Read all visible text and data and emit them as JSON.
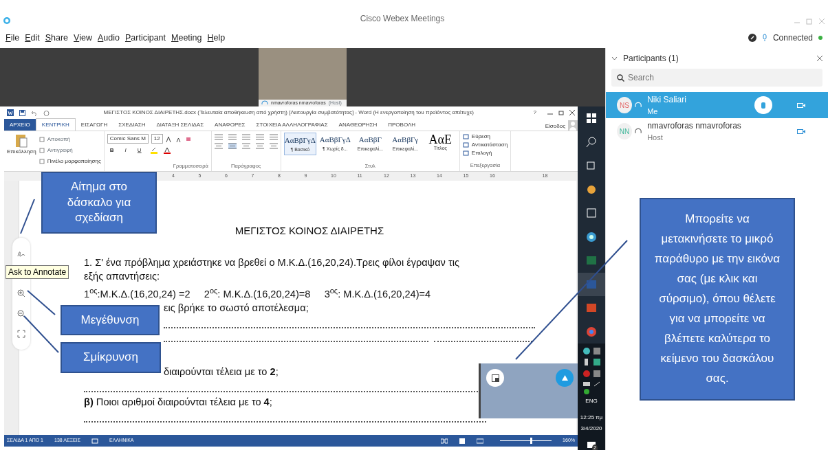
{
  "window": {
    "title": "Cisco Webex Meetings"
  },
  "menu": [
    {
      "label": "File"
    },
    {
      "label": "Edit"
    },
    {
      "label": "Share"
    },
    {
      "label": "View"
    },
    {
      "label": "Audio"
    },
    {
      "label": "Participant"
    },
    {
      "label": "Meeting"
    },
    {
      "label": "Help"
    }
  ],
  "connection": {
    "label": "Connected",
    "connected": true
  },
  "stage": {
    "name": "nmavroforas nmavroforas",
    "role": "(Host)"
  },
  "word": {
    "title": "ΜΕΓΙΣΤΟΣ ΚΟΙΝΟΣ ΔΙΑΙΡΕΤΗΣ.docx (Τελευταία αποθήκευση από χρήστη) [Λειτουργία συμβατότητας] - Word (Η ενεργοποίηση του προϊόντος απέτυχε)",
    "help": "?",
    "tabs": [
      {
        "label": "ΑΡΧΕΙΟ",
        "kind": "file",
        "selected": false
      },
      {
        "label": "ΚΕΝΤΡΙΚΗ",
        "kind": "tab",
        "selected": true
      },
      {
        "label": "ΕΙΣΑΓΩΓΗ",
        "kind": "tab",
        "selected": false
      },
      {
        "label": "ΣΧΕΔΙΑΣΗ",
        "kind": "tab",
        "selected": false
      },
      {
        "label": "ΔΙΑΤΑΞΗ ΣΕΛΙΔΑΣ",
        "kind": "tab",
        "selected": false
      },
      {
        "label": "ΑΝΑΦΟΡΕΣ",
        "kind": "tab",
        "selected": false
      },
      {
        "label": "ΣΤΟΙΧΕΙΑ ΑΛΛΗΛΟΓΡΑΦΙΑΣ",
        "kind": "tab",
        "selected": false
      },
      {
        "label": "ΑΝΑΘΕΩΡΗΣΗ",
        "kind": "tab",
        "selected": false
      },
      {
        "label": "ΠΡΟΒΟΛΗ",
        "kind": "tab",
        "selected": false
      }
    ],
    "sign_in": "Είσοδος",
    "clipboard": {
      "paste": "Επικόλληση",
      "items": [
        "Αποκοπή",
        "Αντιγραφή",
        "Πινέλο μορφοποίησης"
      ]
    },
    "font": {
      "name": "Comic Sans M",
      "size": "12",
      "label": "Γραμματοσειρά",
      "buttons": [
        "B",
        "I",
        "U"
      ]
    },
    "paragraph_label": "Παράγραφος",
    "styles": {
      "label": "Στυλ",
      "items": [
        {
          "sample": "ΑαΒβΓγΔ",
          "name": "¶ Βασικό",
          "selected": true
        },
        {
          "sample": "ΑαΒβΓγΔ",
          "name": "¶ Χωρίς δ...",
          "selected": false
        },
        {
          "sample": "ΑαΒβΓ",
          "name": "Επικεφαλί...",
          "selected": false
        },
        {
          "sample": "ΑαΒβΓγ",
          "name": "Επικεφαλί...",
          "selected": false
        },
        {
          "sample": "ΑαΕ",
          "name": "Τίτλος",
          "selected": false
        }
      ]
    },
    "editing": {
      "label": "Επεξεργασία",
      "items": [
        "Εύρεση",
        "Αντικατάσταση",
        "Επιλογή"
      ]
    },
    "ruler": [
      "4",
      "5",
      "6",
      "7",
      "8",
      "9",
      "10",
      "11",
      "12",
      "13",
      "14",
      "15",
      "16",
      "18"
    ],
    "document": {
      "title": "ΜΕΓΙΣΤΟΣ ΚΟΙΝΟΣ ΔΙΑΙΡΕΤΗΣ",
      "lines": [
        {
          "kind": "text",
          "text": "1. Σ' ένα πρόβλημα χρειάστηκε να βρεθεί ο Μ.Κ.Δ.(16,20,24).Τρεις φίλοι έγραψαν τις"
        },
        {
          "kind": "text",
          "text": "εξής απαντήσεις:"
        },
        {
          "kind": "text",
          "text": "1$^{ος}$:Μ.Κ.Δ.(16,20,24) =2     2$^{ος}$: Μ.Κ.Δ.(16,20,24)=8     3$^{ος}$: Μ.Κ.Δ.(16,20,24)=4"
        },
        {
          "kind": "partial",
          "text": "εις βρήκε το σωστό αποτέλεσμα;"
        },
        {
          "kind": "dots_partial"
        },
        {
          "kind": "dots_split"
        },
        {
          "kind": "partial",
          "text": "διαιρούνται τέλεια με το **2**;"
        },
        {
          "kind": "dots"
        },
        {
          "kind": "text",
          "text": "**β)** Ποιοι αριθμοί διαιρούνται τέλεια με το **4**;"
        },
        {
          "kind": "dots"
        }
      ]
    },
    "status": {
      "items": [
        "ΣΕΛΙΔΑ 1 ΑΠΟ 1",
        "138 ΛΕΞΕΙΣ",
        "ΕΛΛΗΝΙΚΑ"
      ],
      "zoom": "160%",
      "level": 0.58
    }
  },
  "annotate_tooltip": "Ask to Annotate",
  "taskbar": {
    "language": "ENG",
    "time": "12:25 πμ",
    "date": "3/4/2020",
    "notifications": "2"
  },
  "participants": {
    "title": "Participants (1)",
    "search": {
      "placeholder": "Search"
    },
    "items": [
      {
        "initials": "NS",
        "color": "#e46a6a",
        "name": "Niki Saliari",
        "role": "Me",
        "selected": true,
        "hand_raised": true
      },
      {
        "initials": "NN",
        "color": "#3fb79a",
        "name": "nmavroforas nmavroforas",
        "role": "Host",
        "selected": false,
        "hand_raised": false
      }
    ]
  },
  "callouts": [
    {
      "text": "Αίτημα στο δάσκαλο για σχεδίαση"
    },
    {
      "text": "Μεγέθυνση"
    },
    {
      "text": "Σμίκρυνση"
    },
    {
      "text": "Μπορείτε να μετακινήσετε το μικρό παράθυρο με την εικόνα σας (με κλικ και σύρσιμο), όπου θέλετε για να μπορείτε να βλέπετε καλύτερα το κείμενο του δασκάλου σας."
    }
  ]
}
